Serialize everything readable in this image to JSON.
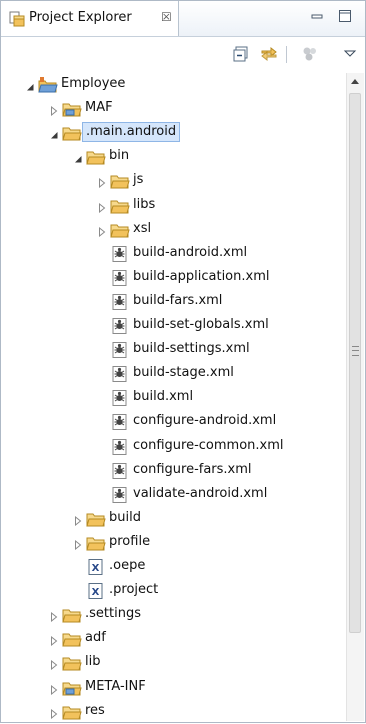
{
  "view": {
    "title": "Project Explorer",
    "close_glyph": "☒",
    "icons": {
      "tab": "project-explorer-icon",
      "minimize": "minimize-icon",
      "maximize": "maximize-icon"
    }
  },
  "toolbar": {
    "items": [
      {
        "name": "collapse-all-icon"
      },
      {
        "name": "link-with-editor-icon"
      },
      {
        "name": "filter-icon"
      },
      {
        "name": "view-menu-icon"
      }
    ]
  },
  "tree": {
    "rows": [
      {
        "label": "Employee",
        "depth": 0,
        "toggle": "expanded",
        "icon": "project-icon"
      },
      {
        "label": "MAF",
        "depth": 1,
        "toggle": "collapsed",
        "icon": "folder-special-icon"
      },
      {
        "label": ".main.android",
        "depth": 1,
        "toggle": "expanded",
        "icon": "folder-icon",
        "selected": true
      },
      {
        "label": "bin",
        "depth": 2,
        "toggle": "expanded",
        "icon": "folder-icon"
      },
      {
        "label": "js",
        "depth": 3,
        "toggle": "collapsed",
        "icon": "folder-icon"
      },
      {
        "label": "libs",
        "depth": 3,
        "toggle": "collapsed",
        "icon": "folder-icon"
      },
      {
        "label": "xsl",
        "depth": 3,
        "toggle": "collapsed",
        "icon": "folder-icon"
      },
      {
        "label": "build-android.xml",
        "depth": 3,
        "toggle": "none",
        "icon": "ant-file-icon"
      },
      {
        "label": "build-application.xml",
        "depth": 3,
        "toggle": "none",
        "icon": "ant-file-icon"
      },
      {
        "label": "build-fars.xml",
        "depth": 3,
        "toggle": "none",
        "icon": "ant-file-icon"
      },
      {
        "label": "build-set-globals.xml",
        "depth": 3,
        "toggle": "none",
        "icon": "ant-file-icon"
      },
      {
        "label": "build-settings.xml",
        "depth": 3,
        "toggle": "none",
        "icon": "ant-file-icon"
      },
      {
        "label": "build-stage.xml",
        "depth": 3,
        "toggle": "none",
        "icon": "ant-file-icon"
      },
      {
        "label": "build.xml",
        "depth": 3,
        "toggle": "none",
        "icon": "ant-file-icon"
      },
      {
        "label": "configure-android.xml",
        "depth": 3,
        "toggle": "none",
        "icon": "ant-file-icon"
      },
      {
        "label": "configure-common.xml",
        "depth": 3,
        "toggle": "none",
        "icon": "ant-file-icon"
      },
      {
        "label": "configure-fars.xml",
        "depth": 3,
        "toggle": "none",
        "icon": "ant-file-icon"
      },
      {
        "label": "validate-android.xml",
        "depth": 3,
        "toggle": "none",
        "icon": "ant-file-icon"
      },
      {
        "label": "build",
        "depth": 2,
        "toggle": "collapsed",
        "icon": "folder-icon"
      },
      {
        "label": "profile",
        "depth": 2,
        "toggle": "collapsed",
        "icon": "folder-icon"
      },
      {
        "label": ".oepe",
        "depth": 2,
        "toggle": "none",
        "icon": "xml-file-icon"
      },
      {
        "label": ".project",
        "depth": 2,
        "toggle": "none",
        "icon": "xml-file-icon"
      },
      {
        "label": ".settings",
        "depth": 1,
        "toggle": "collapsed",
        "icon": "folder-icon"
      },
      {
        "label": "adf",
        "depth": 1,
        "toggle": "collapsed",
        "icon": "folder-icon"
      },
      {
        "label": "lib",
        "depth": 1,
        "toggle": "collapsed",
        "icon": "folder-icon"
      },
      {
        "label": "META-INF",
        "depth": 1,
        "toggle": "collapsed",
        "icon": "folder-special-icon"
      },
      {
        "label": "res",
        "depth": 1,
        "toggle": "collapsed",
        "icon": "folder-icon"
      }
    ]
  },
  "scrollbar": {
    "scroll_fraction": 0.0,
    "visible_fraction": 0.84
  },
  "colors": {
    "selection_bg": "#d5e6fb",
    "selection_border": "#8fb6e6",
    "folder": "#f2c25c",
    "panel_border": "#aeb9c6"
  }
}
